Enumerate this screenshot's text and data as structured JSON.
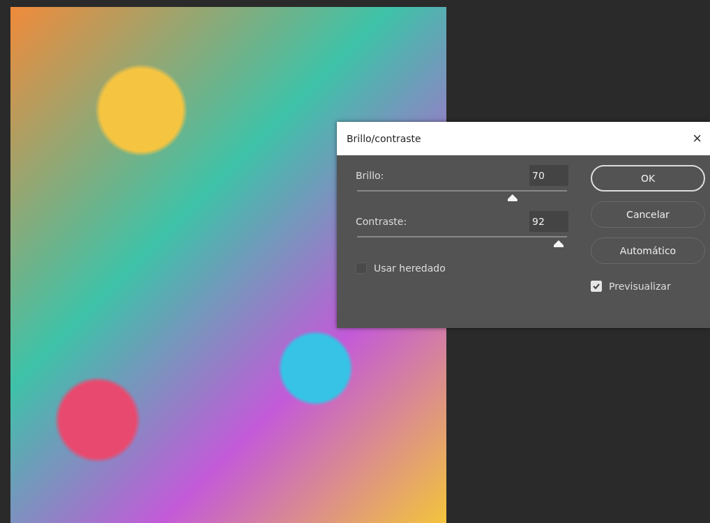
{
  "dialog": {
    "title": "Brillo/contraste",
    "close": "×",
    "sliders": [
      {
        "label": "Brillo:",
        "value": "70",
        "level": 0.74
      },
      {
        "label": "Contraste:",
        "value": "92",
        "level": 0.96
      }
    ],
    "legacy": {
      "label": "Usar heredado",
      "checked": false
    },
    "buttons": [
      {
        "label": "OK",
        "default": true
      },
      {
        "label": "Cancelar",
        "default": false
      },
      {
        "label": "Automático",
        "default": false
      }
    ],
    "preview": {
      "label": "Previsualizar",
      "checked": true
    }
  }
}
